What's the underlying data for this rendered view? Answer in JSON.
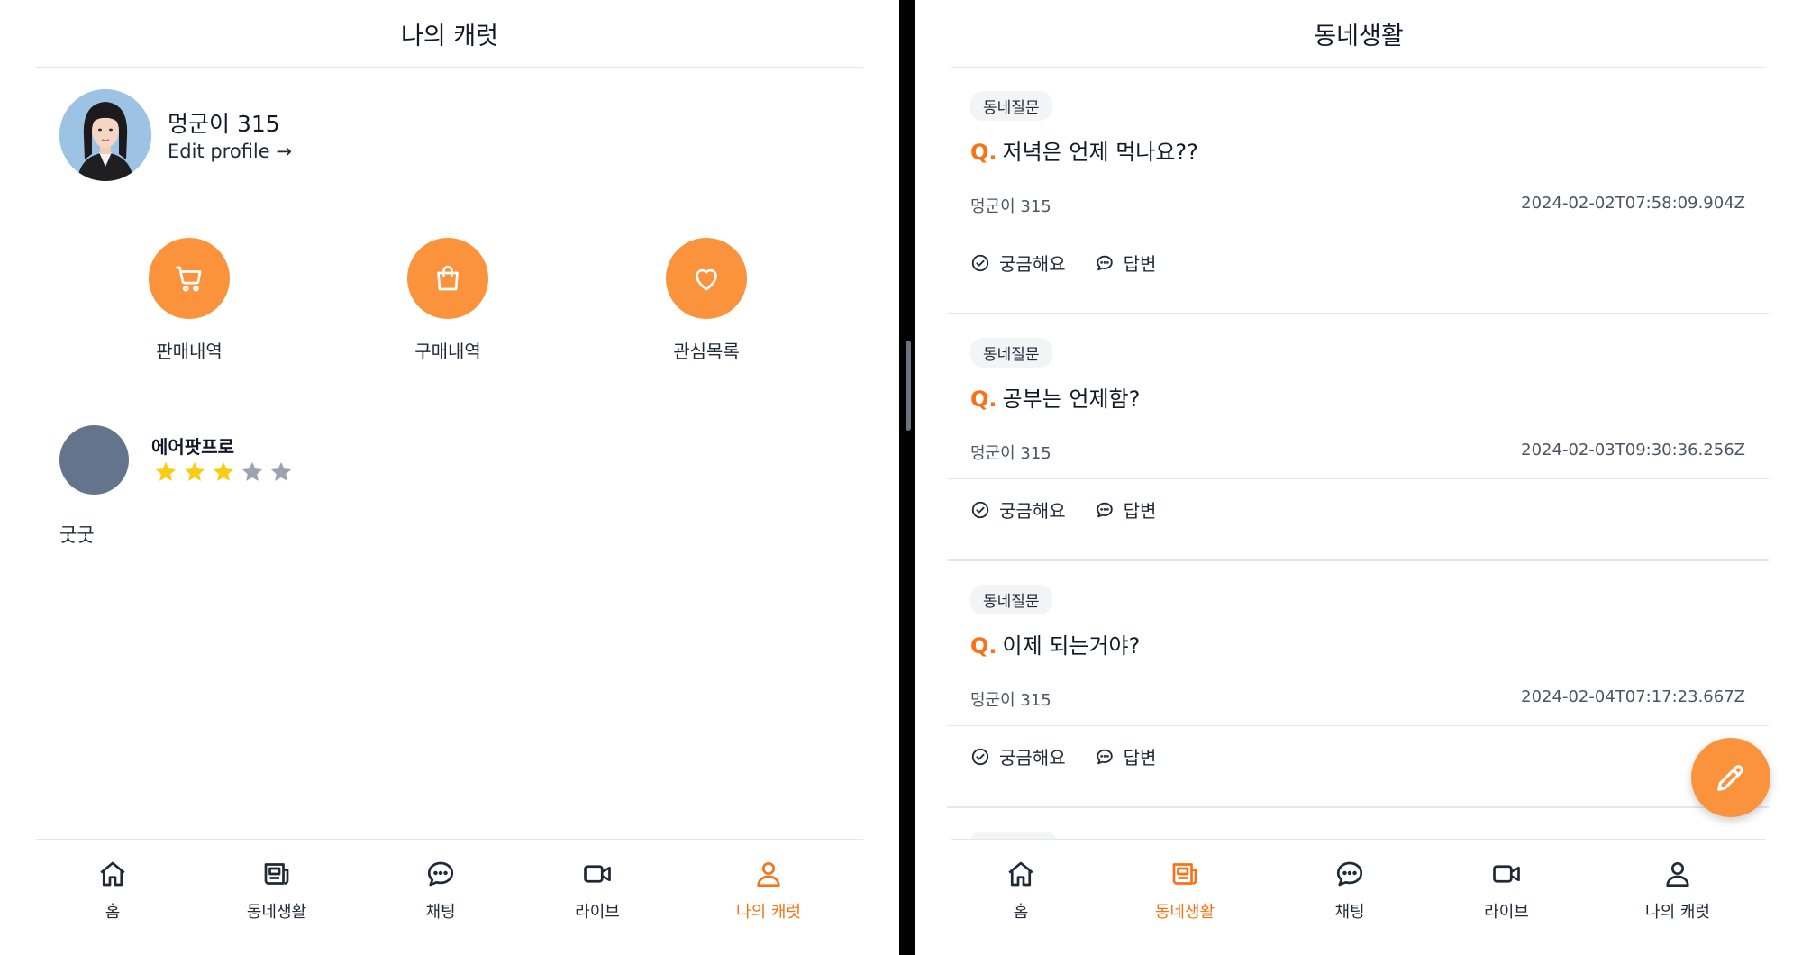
{
  "left": {
    "header_title": "나의 캐럿",
    "profile": {
      "name": "멍군이 315",
      "edit_label": "Edit profile →"
    },
    "actions": [
      {
        "label": "판매내역",
        "icon": "cart-icon"
      },
      {
        "label": "구매내역",
        "icon": "shopping-bag-icon"
      },
      {
        "label": "관심목록",
        "icon": "heart-icon"
      }
    ],
    "review": {
      "reviewer": "에어팟프로",
      "rating": 3,
      "max_rating": 5,
      "text": "굿굿"
    }
  },
  "right": {
    "header_title": "동네생활",
    "posts": [
      {
        "tag": "동네질문",
        "q_prefix": "Q.",
        "question": "저녁은 언제 먹나요??",
        "author": "멍군이 315",
        "date": "2024-02-02T07:58:09.904Z",
        "curious_label": "궁금해요",
        "answer_label": "답변"
      },
      {
        "tag": "동네질문",
        "q_prefix": "Q.",
        "question": "공부는 언제함?",
        "author": "멍군이 315",
        "date": "2024-02-03T09:30:36.256Z",
        "curious_label": "궁금해요",
        "answer_label": "답변"
      },
      {
        "tag": "동네질문",
        "q_prefix": "Q.",
        "question": "이제 되는거야?",
        "author": "멍군이 315",
        "date": "2024-02-04T07:17:23.667Z",
        "curious_label": "궁금해요",
        "answer_label": "답변"
      }
    ],
    "fab_icon": "pencil-icon"
  },
  "nav": [
    {
      "label": "홈",
      "icon": "home-icon"
    },
    {
      "label": "동네생활",
      "icon": "newspaper-icon"
    },
    {
      "label": "채팅",
      "icon": "chat-icon"
    },
    {
      "label": "라이브",
      "icon": "video-icon"
    },
    {
      "label": "나의 캐럿",
      "icon": "user-icon"
    }
  ],
  "colors": {
    "accent": "#f97316",
    "action_circle": "#fb923c",
    "star_filled": "#facc15",
    "star_empty": "#9ca3af",
    "avatar_placeholder": "#64748b"
  }
}
